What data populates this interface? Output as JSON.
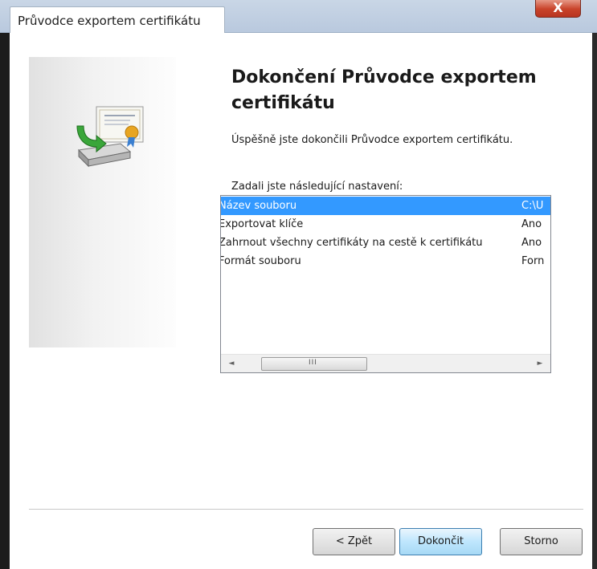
{
  "window": {
    "title": "Průvodce exportem certifikátu",
    "close_glyph": "X"
  },
  "wizard": {
    "heading": "Dokončení Průvodce exportem certifikátu",
    "success_text": "Úspěšně jste dokončili Průvodce exportem certifikátu.",
    "settings_label": "Zadali jste následující nastavení:",
    "icon": "certificate-export-icon",
    "settings": [
      {
        "name": "Název souboru",
        "value": "C:\\U",
        "selected": true
      },
      {
        "name": "Exportovat klíče",
        "value": "Ano",
        "selected": false
      },
      {
        "name": "Zahrnout všechny certifikáty na cestě k certifikátu",
        "value": "Ano",
        "selected": false
      },
      {
        "name": "Formát souboru",
        "value": "Forn",
        "selected": false
      }
    ],
    "scrollbar": {
      "left_arrow": "◄",
      "right_arrow": "►",
      "grip": "III"
    }
  },
  "buttons": {
    "back": "< Zpět",
    "finish": "Dokončit",
    "cancel": "Storno"
  },
  "colors": {
    "selection": "#3399ff",
    "close_button": "#c9442b"
  }
}
